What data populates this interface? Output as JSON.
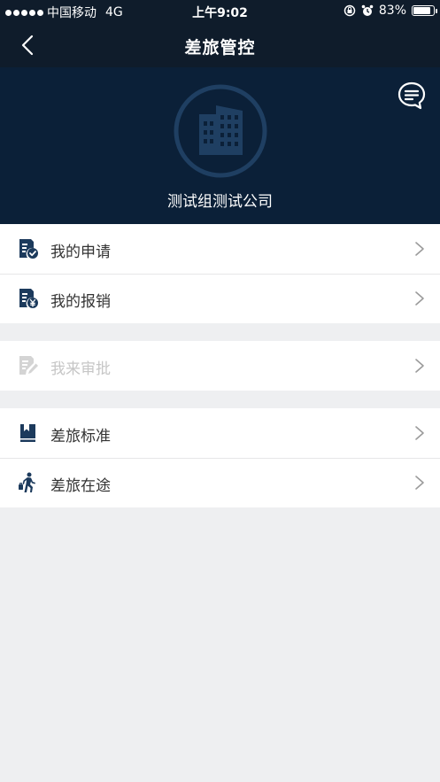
{
  "status_bar": {
    "carrier": "中国移动",
    "network": "4G",
    "time": "上午9:02",
    "battery": "83%",
    "battery_level": 0.83
  },
  "nav": {
    "title": "差旅管控",
    "back_icon": "chevron-left-icon"
  },
  "header": {
    "company_name": "测试组测试公司",
    "message_icon": "chat-bubble-icon",
    "logo_icon": "building-icon"
  },
  "colors": {
    "nav_bg": "#0f1c2b",
    "hero_bg": "#0b2038",
    "icon_primary": "#1c3a5c",
    "disabled": "#c6c6c6"
  },
  "menu": {
    "group1": [
      {
        "label": "我的申请",
        "icon": "application-doc-icon"
      },
      {
        "label": "我的报销",
        "icon": "reimbursement-doc-icon"
      }
    ],
    "group2": [
      {
        "label": "我来审批",
        "icon": "approval-edit-icon",
        "disabled": true
      }
    ],
    "group3": [
      {
        "label": "差旅标准",
        "icon": "bookmark-book-icon"
      },
      {
        "label": "差旅在途",
        "icon": "walking-traveler-icon"
      }
    ]
  }
}
